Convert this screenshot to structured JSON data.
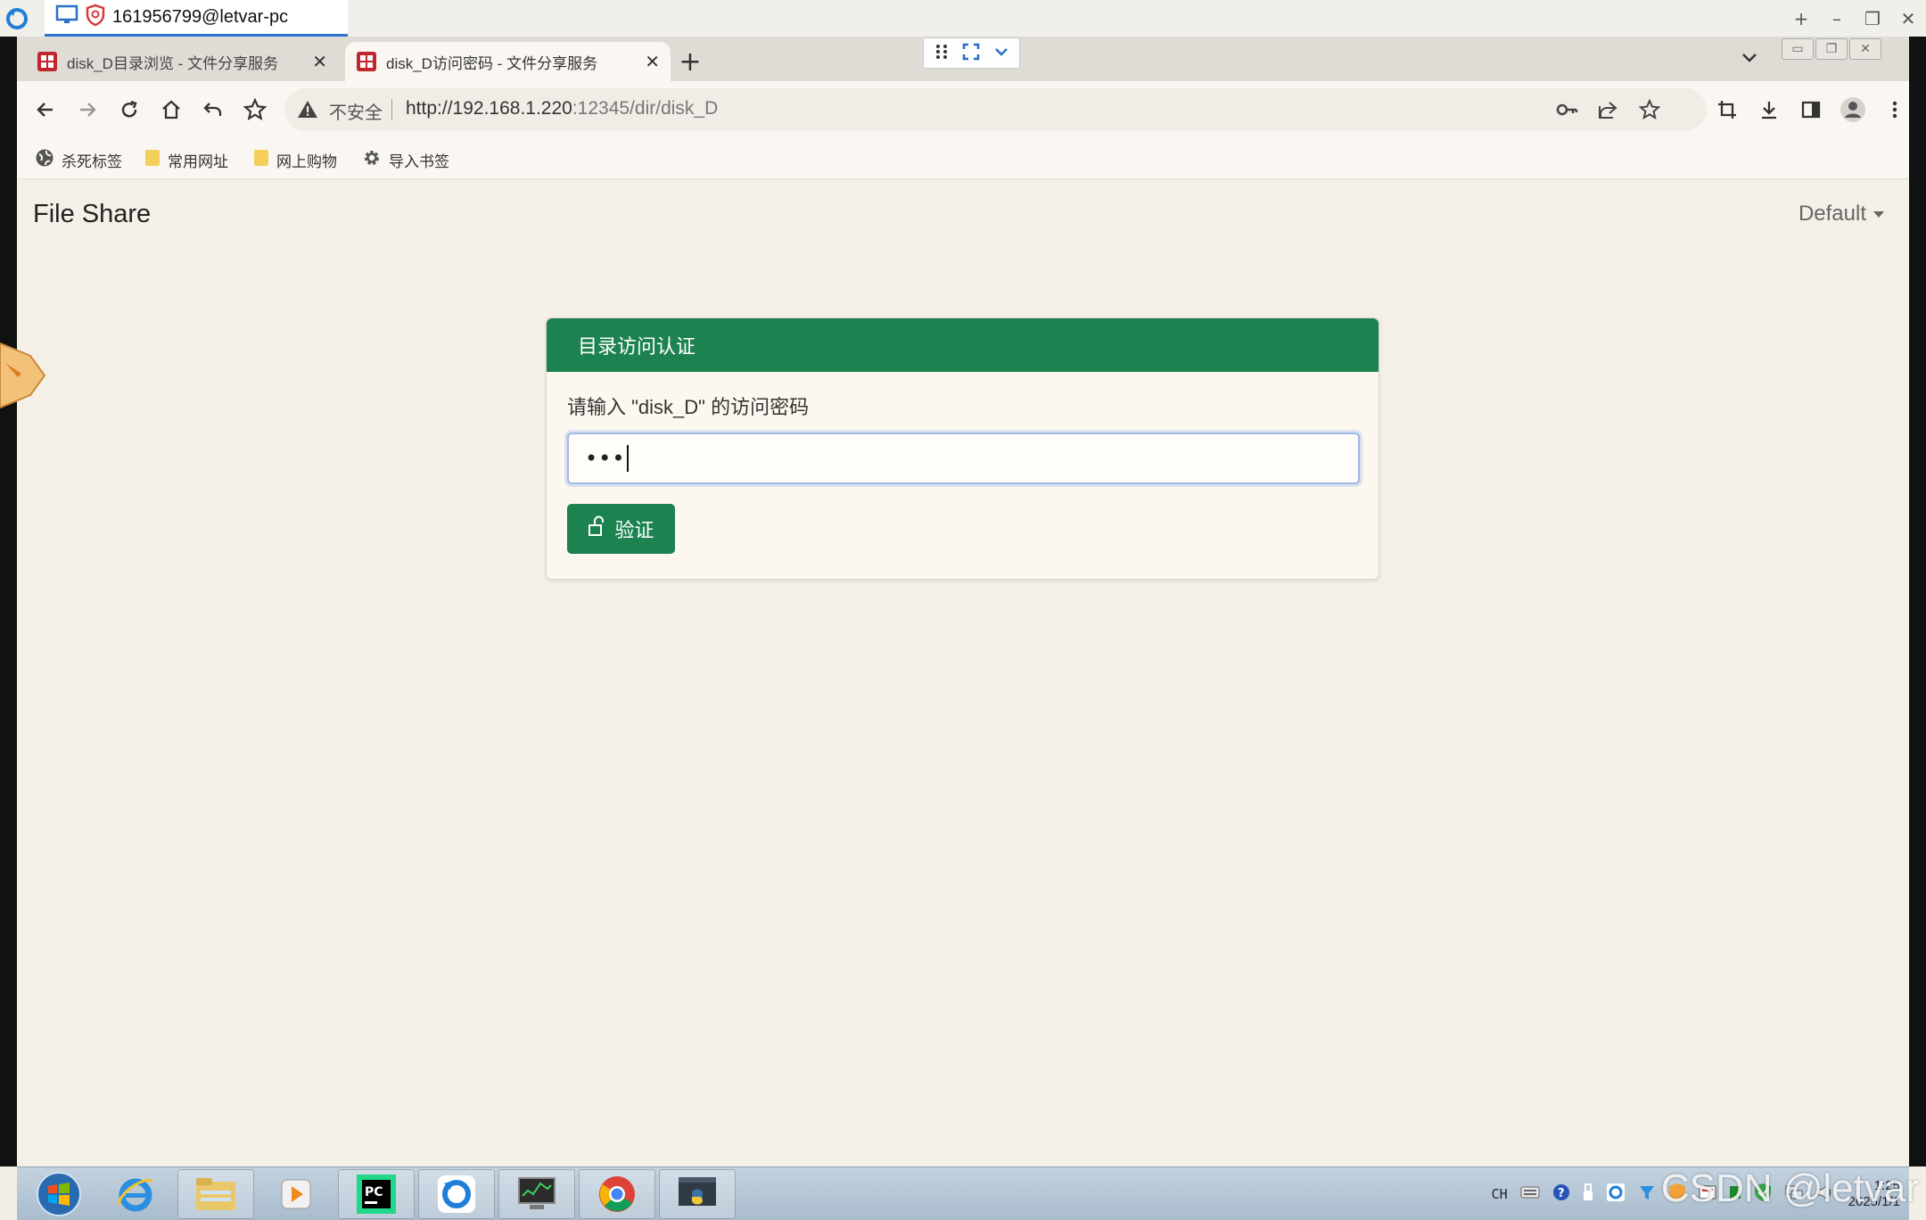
{
  "remote_desktop": {
    "tab_title": "161956799@letvar-pc"
  },
  "browser": {
    "tabs": [
      {
        "label": "disk_D目录浏览 - 文件分享服务",
        "active": false
      },
      {
        "label": "disk_D访问密码 - 文件分享服务",
        "active": true
      }
    ],
    "address": {
      "security_label": "不安全",
      "url_host": "http://192.168.1.220",
      "url_rest": ":12345/dir/disk_D"
    },
    "bookmarks": [
      {
        "label": "杀死标签",
        "icon": "globe-icon"
      },
      {
        "label": "常用网址",
        "icon": "folder-icon"
      },
      {
        "label": "网上购物",
        "icon": "folder-icon"
      },
      {
        "label": "导入书签",
        "icon": "gear-icon"
      }
    ]
  },
  "page": {
    "brand": "File Share",
    "theme_selector": "Default",
    "card": {
      "header": "目录访问认证",
      "prompt": "请输入 \"disk_D\" 的访问密码",
      "password_masked": "•••",
      "verify_button": "验证"
    }
  },
  "taskbar": {
    "tray_lang": "CH",
    "clock_time": "1:25",
    "clock_date": "2025/1/1"
  },
  "watermark": "CSDN @letvar",
  "colors": {
    "accent_green": "#1c8250",
    "page_bg": "#f4f0e7",
    "focus_ring": "#9fb7e2"
  }
}
